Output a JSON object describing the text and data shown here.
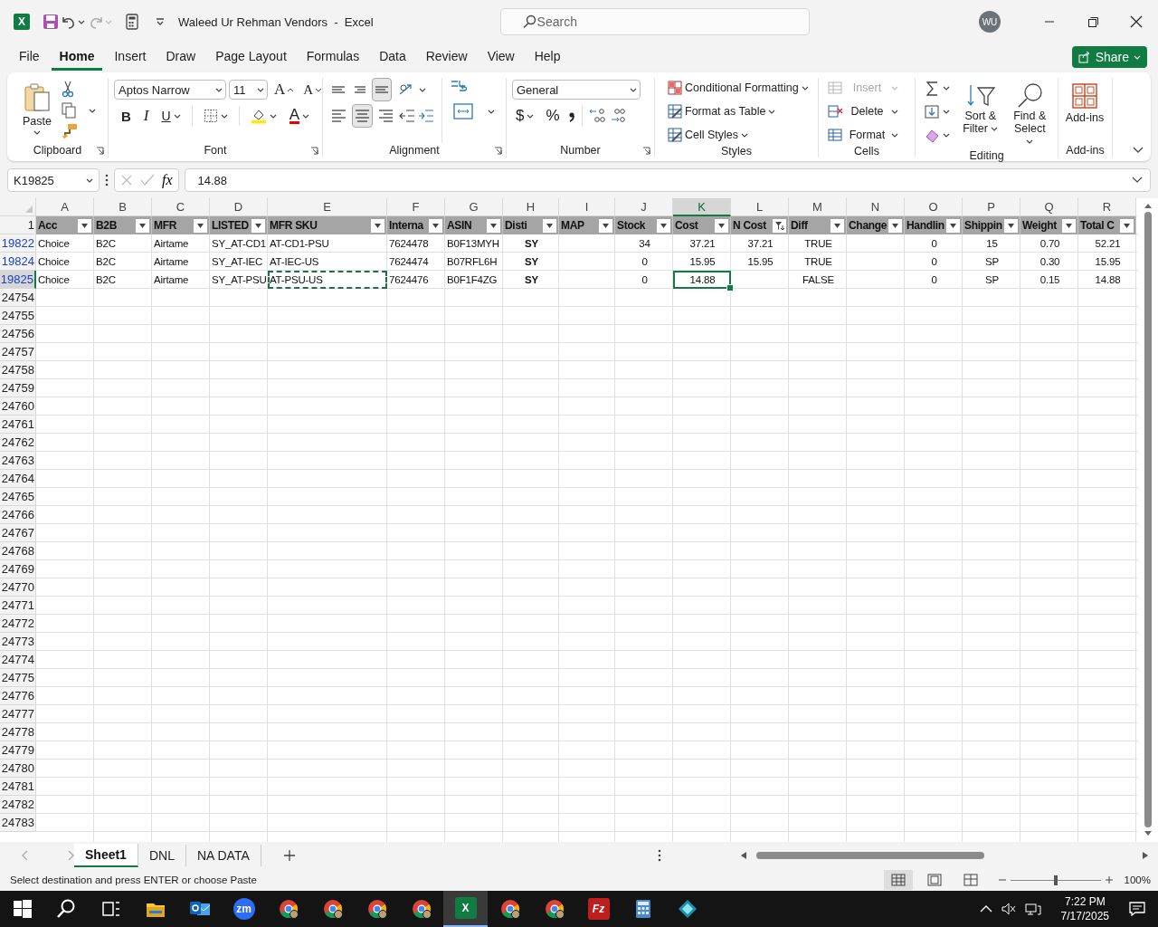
{
  "window": {
    "logo_glyph": "X",
    "title": "Waleed Ur Rehman Vendors  -  Excel",
    "search_placeholder": "Search",
    "user_initials": "WU"
  },
  "menu_tabs": [
    {
      "label": "File",
      "selected": false
    },
    {
      "label": "Home",
      "selected": true
    },
    {
      "label": "Insert",
      "selected": false
    },
    {
      "label": "Draw",
      "selected": false
    },
    {
      "label": "Page Layout",
      "selected": false
    },
    {
      "label": "Formulas",
      "selected": false
    },
    {
      "label": "Data",
      "selected": false
    },
    {
      "label": "Review",
      "selected": false
    },
    {
      "label": "View",
      "selected": false
    },
    {
      "label": "Help",
      "selected": false
    }
  ],
  "share_button": "Share",
  "ribbon": {
    "clipboard": {
      "label": "Clipboard",
      "paste": "Paste"
    },
    "font": {
      "label": "Font",
      "font_name": "Aptos Narrow",
      "font_size": "11",
      "grow": "A",
      "shrink": "A",
      "bold": "B",
      "italic": "I",
      "underline": "U",
      "font_color": "A"
    },
    "alignment": {
      "label": "Alignment",
      "buttons": [
        {
          "kind": "top",
          "selected": false
        },
        {
          "kind": "middle",
          "selected": false
        },
        {
          "kind": "bottom",
          "selected": true
        },
        {
          "kind": "left",
          "selected": false
        },
        {
          "kind": "center",
          "selected": true
        },
        {
          "kind": "right",
          "selected": false
        }
      ]
    },
    "number": {
      "label": "Number",
      "format": "General",
      "currency": "$",
      "percent": "%"
    },
    "styles": {
      "label": "Styles",
      "items": [
        "Conditional Formatting",
        "Format as Table",
        "Cell Styles"
      ]
    },
    "cells": {
      "label": "Cells",
      "items": [
        {
          "label": "Insert",
          "disabled": true
        },
        {
          "label": "Delete",
          "disabled": false
        },
        {
          "label": "Format",
          "disabled": false
        }
      ]
    },
    "editing": {
      "label": "Editing",
      "sort": "Sort & Filter",
      "find": "Find & Select"
    },
    "addins": {
      "label": "Add-ins",
      "button": "Add-ins"
    }
  },
  "formula_bar": {
    "name_box": "K19825",
    "function_button": "fx",
    "formula": "14.88"
  },
  "sheet": {
    "columns": [
      {
        "letter": "A",
        "selected": false
      },
      {
        "letter": "B",
        "selected": false
      },
      {
        "letter": "C",
        "selected": false
      },
      {
        "letter": "D",
        "selected": false
      },
      {
        "letter": "E",
        "selected": false
      },
      {
        "letter": "F",
        "selected": false
      },
      {
        "letter": "G",
        "selected": false
      },
      {
        "letter": "H",
        "selected": false
      },
      {
        "letter": "I",
        "selected": false
      },
      {
        "letter": "J",
        "selected": false
      },
      {
        "letter": "K",
        "selected": true
      },
      {
        "letter": "L",
        "selected": false
      },
      {
        "letter": "M",
        "selected": false
      },
      {
        "letter": "N",
        "selected": false
      },
      {
        "letter": "O",
        "selected": false
      },
      {
        "letter": "P",
        "selected": false
      },
      {
        "letter": "Q",
        "selected": false
      },
      {
        "letter": "R",
        "selected": false
      }
    ],
    "header_row": {
      "number": "1",
      "cells": [
        {
          "text": "Acc",
          "filter_active": false
        },
        {
          "text": "B2B",
          "filter_active": false
        },
        {
          "text": "MFR",
          "filter_active": false
        },
        {
          "text": "LISTED",
          "filter_active": false
        },
        {
          "text": "MFR SKU",
          "filter_active": false
        },
        {
          "text": "Interna",
          "filter_active": false
        },
        {
          "text": "ASIN",
          "filter_active": false
        },
        {
          "text": "Disti",
          "filter_active": false
        },
        {
          "text": "MAP",
          "filter_active": false
        },
        {
          "text": "Stock",
          "filter_active": false
        },
        {
          "text": "Cost",
          "filter_active": false
        },
        {
          "text": "N Cost",
          "filter_active": true
        },
        {
          "text": "Diff",
          "filter_active": false
        },
        {
          "text": "Change",
          "filter_active": false
        },
        {
          "text": "Handlin",
          "filter_active": false
        },
        {
          "text": "Shippin",
          "filter_active": false
        },
        {
          "text": "Weight",
          "filter_active": false
        },
        {
          "text": "Total C",
          "filter_active": false
        }
      ]
    },
    "rows": [
      {
        "number": "19822",
        "filtered": true,
        "selected": false,
        "cells": [
          {
            "text": "Choice",
            "selected": false,
            "copy_marked": false
          },
          {
            "text": "B2C",
            "selected": false,
            "copy_marked": false
          },
          {
            "text": "Airtame",
            "selected": false,
            "copy_marked": false
          },
          {
            "text": "SY_AT-CD1",
            "selected": false,
            "copy_marked": false
          },
          {
            "text": "AT-CD1-PSU",
            "selected": false,
            "copy_marked": false
          },
          {
            "text": "7624478",
            "selected": false,
            "copy_marked": false
          },
          {
            "text": "B0F13MYH",
            "selected": false,
            "copy_marked": false
          },
          {
            "text": "SY",
            "selected": false,
            "copy_marked": false
          },
          null,
          {
            "text": "34",
            "selected": false,
            "copy_marked": false
          },
          {
            "text": "37.21",
            "selected": false,
            "copy_marked": false
          },
          {
            "text": "37.21",
            "selected": false,
            "copy_marked": false
          },
          {
            "text": "TRUE",
            "selected": false,
            "copy_marked": false
          },
          null,
          {
            "text": "0",
            "selected": false,
            "copy_marked": false
          },
          {
            "text": "15",
            "selected": false,
            "copy_marked": false
          },
          {
            "text": "0.70",
            "selected": false,
            "copy_marked": false
          },
          {
            "text": "52.21",
            "selected": false,
            "copy_marked": false
          }
        ]
      },
      {
        "number": "19824",
        "filtered": true,
        "selected": false,
        "cells": [
          {
            "text": "Choice",
            "selected": false,
            "copy_marked": false
          },
          {
            "text": "B2C",
            "selected": false,
            "copy_marked": false
          },
          {
            "text": "Airtame",
            "selected": false,
            "copy_marked": false
          },
          {
            "text": "SY_AT-IEC",
            "selected": false,
            "copy_marked": false
          },
          {
            "text": "AT-IEC-US",
            "selected": false,
            "copy_marked": false
          },
          {
            "text": "7624474",
            "selected": false,
            "copy_marked": false
          },
          {
            "text": "B07RFL6H",
            "selected": false,
            "copy_marked": false
          },
          {
            "text": "SY",
            "selected": false,
            "copy_marked": false
          },
          null,
          {
            "text": "0",
            "selected": false,
            "copy_marked": false
          },
          {
            "text": "15.95",
            "selected": false,
            "copy_marked": false
          },
          {
            "text": "15.95",
            "selected": false,
            "copy_marked": false
          },
          {
            "text": "TRUE",
            "selected": false,
            "copy_marked": false
          },
          null,
          {
            "text": "0",
            "selected": false,
            "copy_marked": false
          },
          {
            "text": "SP",
            "selected": false,
            "copy_marked": false
          },
          {
            "text": "0.30",
            "selected": false,
            "copy_marked": false
          },
          {
            "text": "15.95",
            "selected": false,
            "copy_marked": false
          }
        ]
      },
      {
        "number": "19825",
        "filtered": true,
        "selected": true,
        "cells": [
          {
            "text": "Choice",
            "selected": false,
            "copy_marked": false
          },
          {
            "text": "B2C",
            "selected": false,
            "copy_marked": false
          },
          {
            "text": "Airtame",
            "selected": false,
            "copy_marked": false
          },
          {
            "text": "SY_AT-PSU",
            "selected": false,
            "copy_marked": false
          },
          {
            "text": "AT-PSU-US",
            "selected": false,
            "copy_marked": true
          },
          {
            "text": "7624476",
            "selected": false,
            "copy_marked": false
          },
          {
            "text": "B0F1F4ZG",
            "selected": false,
            "copy_marked": false
          },
          {
            "text": "SY",
            "selected": false,
            "copy_marked": false
          },
          null,
          {
            "text": "0",
            "selected": false,
            "copy_marked": false
          },
          {
            "text": "14.88",
            "selected": true,
            "copy_marked": false
          },
          null,
          {
            "text": "FALSE",
            "selected": false,
            "copy_marked": false
          },
          null,
          {
            "text": "0",
            "selected": false,
            "copy_marked": false
          },
          {
            "text": "SP",
            "selected": false,
            "copy_marked": false
          },
          {
            "text": "0.15",
            "selected": false,
            "copy_marked": false
          },
          {
            "text": "14.88",
            "selected": false,
            "copy_marked": false
          }
        ]
      }
    ],
    "empty_row_numbers": [
      "24754",
      "24755",
      "24756",
      "24757",
      "24758",
      "24759",
      "24760",
      "24761",
      "24762",
      "24763",
      "24764",
      "24765",
      "24766",
      "24767",
      "24768",
      "24769",
      "24770",
      "24771",
      "24772",
      "24773",
      "24774",
      "24775",
      "24776",
      "24777",
      "24778",
      "24779",
      "24780",
      "24781",
      "24782",
      "24783"
    ]
  },
  "sheet_tabs": [
    {
      "label": "Sheet1",
      "selected": true
    },
    {
      "label": "DNL",
      "selected": false
    },
    {
      "label": "NA DATA",
      "selected": false
    }
  ],
  "status_bar": {
    "message": "Select destination and press ENTER or choose Paste",
    "views": [
      {
        "kind": "normal",
        "selected": true
      },
      {
        "kind": "page_layout",
        "selected": false
      },
      {
        "kind": "page_break",
        "selected": false
      }
    ],
    "zoom": {
      "level": 0.5,
      "reading": "100%"
    }
  },
  "taskbar": {
    "items": [
      {
        "kind": "start",
        "selected": false
      },
      {
        "kind": "search",
        "selected": false
      },
      {
        "kind": "task_view",
        "selected": false
      },
      {
        "kind": "folder",
        "selected": false
      },
      {
        "kind": "mail",
        "selected": false
      },
      {
        "kind": "video_call",
        "glyph": "zm",
        "selected": false
      },
      {
        "kind": "browser",
        "selected": false
      },
      {
        "kind": "browser",
        "selected": false
      },
      {
        "kind": "browser",
        "selected": false
      },
      {
        "kind": "browser",
        "selected": false
      },
      {
        "kind": "spreadsheet",
        "glyph": "X",
        "selected": true
      },
      {
        "kind": "browser",
        "selected": false
      },
      {
        "kind": "browser",
        "selected": false
      },
      {
        "kind": "ftp",
        "glyph": "Fz",
        "selected": false
      },
      {
        "kind": "calculator",
        "selected": false
      },
      {
        "kind": "diamond",
        "selected": false
      }
    ],
    "time": "7:22 PM",
    "date": "7/17/2025"
  }
}
